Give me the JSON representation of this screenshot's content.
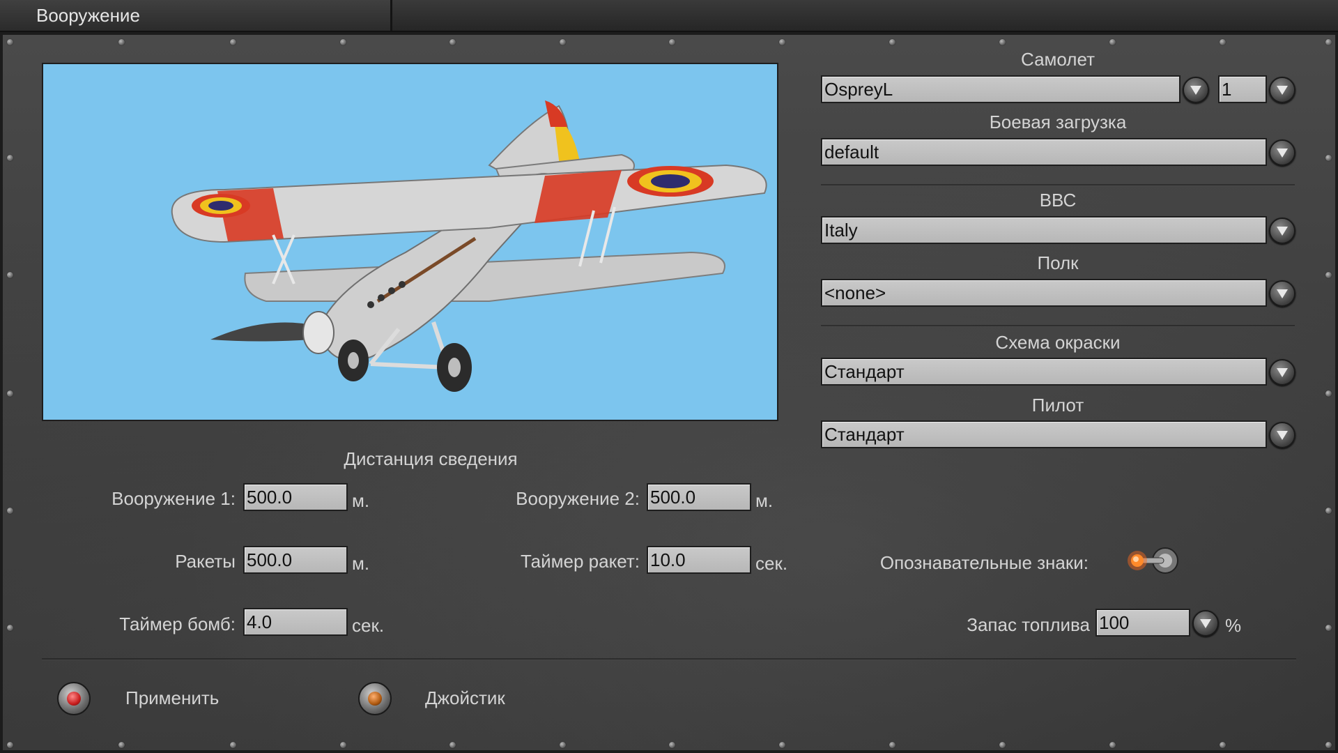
{
  "window": {
    "title": "Вооружение"
  },
  "aircraft": {
    "label": "Самолет",
    "value": "OspreyL",
    "count": "1"
  },
  "loadout": {
    "label": "Боевая загрузка",
    "value": "default"
  },
  "airforce": {
    "label": "ВВС",
    "value": "Italy"
  },
  "regiment": {
    "label": "Полк",
    "value": "<none>"
  },
  "paint_scheme": {
    "label": "Схема окраски",
    "value": "Стандарт"
  },
  "pilot": {
    "label": "Пилот",
    "value": "Стандарт"
  },
  "convergence": {
    "title": "Дистанция сведения",
    "weapon1": {
      "label": "Вооружение 1:",
      "value": "500.0",
      "unit": "м."
    },
    "weapon2": {
      "label": "Вооружение 2:",
      "value": "500.0",
      "unit": "м."
    },
    "rockets": {
      "label": "Ракеты",
      "value": "500.0",
      "unit": "м."
    },
    "rocket_timer": {
      "label": "Таймер ракет:",
      "value": "10.0",
      "unit": "сек."
    },
    "bomb_timer": {
      "label": "Таймер бомб:",
      "value": "4.0",
      "unit": "сек."
    }
  },
  "markings": {
    "label": "Опознавательные знаки:",
    "enabled": true
  },
  "fuel": {
    "label": "Запас топлива",
    "value": "100",
    "unit": "%"
  },
  "buttons": {
    "apply": "Применить",
    "joystick": "Джойстик"
  },
  "colors": {
    "sky": "#7cc5ee",
    "roundel_red": "#d83a24",
    "roundel_yellow": "#f0c21e",
    "roundel_blue": "#2e2c6e",
    "lamp_red": "#c81e1e",
    "lamp_amber": "#b05a10",
    "toggle_glow": "#ff6a1a"
  },
  "icons": {
    "dropdown": "chevron-down-icon",
    "apply_lamp": "red-lamp-icon",
    "joystick_lamp": "amber-lamp-icon"
  }
}
